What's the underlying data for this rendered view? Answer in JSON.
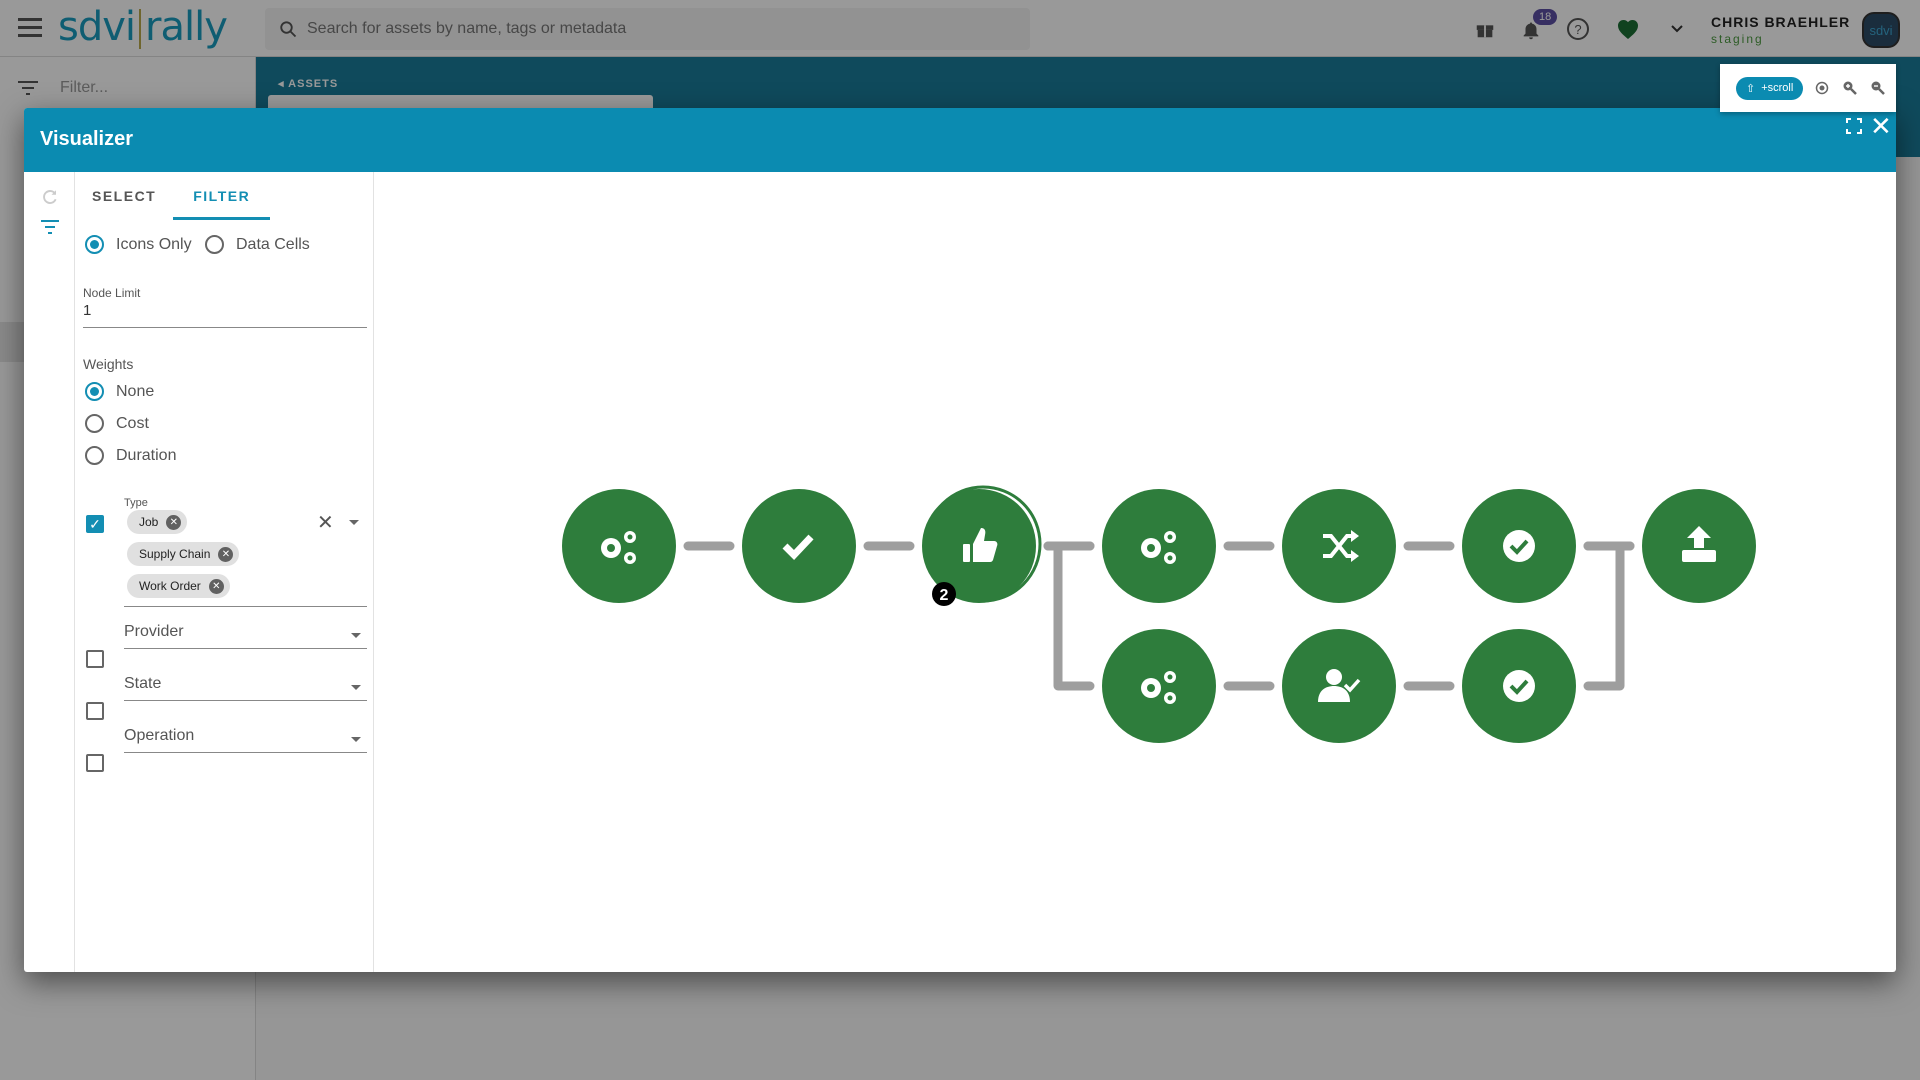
{
  "topbar": {
    "logo_left": "sdvi",
    "logo_right": "rally",
    "search_placeholder": "Search for assets by name, tags or metadata",
    "notifications_count": "18",
    "user_name": "CHRIS BRAEHLER",
    "environment": "staging",
    "avatar_text": "sdvi"
  },
  "leftnav": {
    "filter_placeholder": "Filter..."
  },
  "main": {
    "breadcrumb": "ASSETS"
  },
  "modal": {
    "title": "Visualizer",
    "tabs": [
      {
        "label": "SELECT",
        "active": false
      },
      {
        "label": "FILTER",
        "active": true
      }
    ],
    "display_mode": {
      "options": [
        "Icons Only",
        "Data Cells"
      ],
      "selected": "Icons Only"
    },
    "node_limit": {
      "label": "Node Limit",
      "value": "1"
    },
    "weights": {
      "label": "Weights",
      "options": [
        "None",
        "Cost",
        "Duration"
      ],
      "selected": "None"
    },
    "filters": {
      "type": {
        "label": "Type",
        "checked": true,
        "chips": [
          "Job",
          "Supply Chain",
          "Work Order"
        ]
      },
      "provider": {
        "label": "Provider",
        "checked": false
      },
      "state": {
        "label": "State",
        "checked": false
      },
      "operation": {
        "label": "Operation",
        "checked": false
      }
    },
    "toolbar": {
      "scroll_label": "+scroll"
    }
  },
  "graph": {
    "node_color": "#2e7d3c",
    "edge_color": "#9e9e9e",
    "nodes": [
      {
        "id": "n1",
        "icon": "gears-icon",
        "row": 0,
        "col": 0
      },
      {
        "id": "n2",
        "icon": "check-icon",
        "row": 0,
        "col": 1
      },
      {
        "id": "n3",
        "icon": "thumbs-up-icon",
        "row": 0,
        "col": 2,
        "badge": "2",
        "stacked": true
      },
      {
        "id": "n4",
        "icon": "gears-icon",
        "row": 0,
        "col": 3
      },
      {
        "id": "n5",
        "icon": "shuffle-icon",
        "row": 0,
        "col": 4
      },
      {
        "id": "n6",
        "icon": "check-circle-icon",
        "row": 0,
        "col": 5
      },
      {
        "id": "n7",
        "icon": "upload-icon",
        "row": 0,
        "col": 6
      },
      {
        "id": "n8",
        "icon": "gears-icon",
        "row": 1,
        "col": 3
      },
      {
        "id": "n9",
        "icon": "user-check-icon",
        "row": 1,
        "col": 4
      },
      {
        "id": "n10",
        "icon": "check-circle-icon",
        "row": 1,
        "col": 5
      }
    ],
    "edges": [
      [
        "n1",
        "n2"
      ],
      [
        "n2",
        "n3"
      ],
      [
        "n3",
        "n4"
      ],
      [
        "n3",
        "n8"
      ],
      [
        "n4",
        "n5"
      ],
      [
        "n5",
        "n6"
      ],
      [
        "n6",
        "n7"
      ],
      [
        "n8",
        "n9"
      ],
      [
        "n9",
        "n10"
      ],
      [
        "n10",
        "n7"
      ]
    ]
  }
}
